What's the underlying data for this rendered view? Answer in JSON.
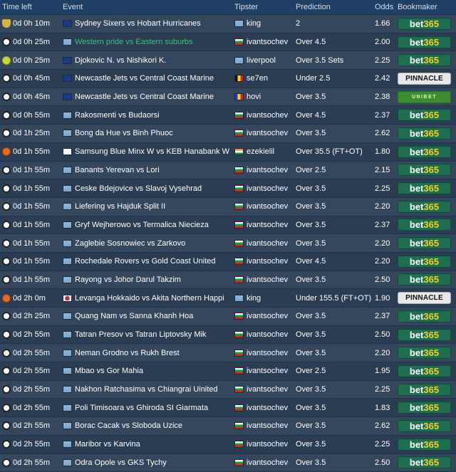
{
  "headers": {
    "time": "Time left",
    "event": "Event",
    "tipster": "Tipster",
    "prediction": "Prediction",
    "odds": "Odds",
    "bookmaker": "Bookmaker"
  },
  "bookmakers": {
    "bet365": "bet365",
    "pinnacle": "PINNACLE",
    "unibet": "UNIBET"
  },
  "colors": {
    "header_bg": "#1f3f64",
    "row_odd": "#34475d",
    "row_even": "#2b3d52",
    "highlight_event": "#3fbf7f",
    "bet365_green": "#1e6e52",
    "bet365_yellow": "#f3d21b"
  },
  "rows": [
    {
      "time": "0d 0h 10m",
      "sport": "trophy-icon",
      "event_flag": "au",
      "event": "Sydney Sixers vs Hobart Hurricanes",
      "highlight": false,
      "tipster_flag": "int",
      "tipster": "king",
      "prediction": "2",
      "odds": "1.66",
      "bookmaker": "bet365"
    },
    {
      "time": "0d 0h 25m",
      "sport": "soccer-ball-icon",
      "event_flag": "int",
      "event": "Western pride vs Eastern suburbs",
      "highlight": true,
      "tipster_flag": "bg",
      "tipster": "ivantsochev",
      "prediction": "Over 4.5",
      "odds": "2.00",
      "bookmaker": "bet365"
    },
    {
      "time": "0d 0h 25m",
      "sport": "tennis-ball-icon",
      "event_flag": "au",
      "event": "Djokovic N. vs Nishikori K.",
      "highlight": false,
      "tipster_flag": "int",
      "tipster": "liverpool",
      "prediction": "Over 3.5 Sets",
      "odds": "2.25",
      "bookmaker": "bet365"
    },
    {
      "time": "0d 0h 45m",
      "sport": "soccer-ball-icon",
      "event_flag": "au",
      "event": "Newcastle Jets vs Central Coast Marine",
      "highlight": false,
      "tipster_flag": "be",
      "tipster": "se7en",
      "prediction": "Under 2.5",
      "odds": "2.42",
      "bookmaker": "pinnacle"
    },
    {
      "time": "0d 0h 45m",
      "sport": "soccer-ball-icon",
      "event_flag": "au",
      "event": "Newcastle Jets vs Central Coast Marine",
      "highlight": false,
      "tipster_flag": "ro",
      "tipster": "hovi",
      "prediction": "Over 3.5",
      "odds": "2.38",
      "bookmaker": "unibet"
    },
    {
      "time": "0d 0h 55m",
      "sport": "soccer-ball-icon",
      "event_flag": "int",
      "event": "Rakosmenti vs Budaorsi",
      "highlight": false,
      "tipster_flag": "bg",
      "tipster": "ivantsochev",
      "prediction": "Over 4.5",
      "odds": "2.37",
      "bookmaker": "bet365"
    },
    {
      "time": "0d 1h 25m",
      "sport": "soccer-ball-icon",
      "event_flag": "int",
      "event": "Bong da Hue vs Binh Phuoc",
      "highlight": false,
      "tipster_flag": "bg",
      "tipster": "ivantsochev",
      "prediction": "Over 3.5",
      "odds": "2.62",
      "bookmaker": "bet365"
    },
    {
      "time": "0d 1h 55m",
      "sport": "basketball-icon",
      "event_flag": "kr",
      "event": "Samsung Blue Minx W vs KEB Hanabank W",
      "highlight": false,
      "tipster_flag": "in",
      "tipster": "ezekielil",
      "prediction": "Over 35.5 (FT+OT)",
      "odds": "1.80",
      "bookmaker": "bet365"
    },
    {
      "time": "0d 1h 55m",
      "sport": "soccer-ball-icon",
      "event_flag": "int",
      "event": "Banants Yerevan vs Lori",
      "highlight": false,
      "tipster_flag": "bg",
      "tipster": "ivantsochev",
      "prediction": "Over 2.5",
      "odds": "2.15",
      "bookmaker": "bet365"
    },
    {
      "time": "0d 1h 55m",
      "sport": "soccer-ball-icon",
      "event_flag": "int",
      "event": "Ceske Bdejovice vs Slavoj Vysehrad",
      "highlight": false,
      "tipster_flag": "bg",
      "tipster": "ivantsochev",
      "prediction": "Over 3.5",
      "odds": "2.25",
      "bookmaker": "bet365"
    },
    {
      "time": "0d 1h 55m",
      "sport": "soccer-ball-icon",
      "event_flag": "int",
      "event": "Liefering vs Hajduk Split II",
      "highlight": false,
      "tipster_flag": "bg",
      "tipster": "ivantsochev",
      "prediction": "Over 3.5",
      "odds": "2.20",
      "bookmaker": "bet365"
    },
    {
      "time": "0d 1h 55m",
      "sport": "soccer-ball-icon",
      "event_flag": "int",
      "event": "Gryf Wejherowo vs Termalica Niecieza",
      "highlight": false,
      "tipster_flag": "bg",
      "tipster": "ivantsochev",
      "prediction": "Over 3.5",
      "odds": "2.37",
      "bookmaker": "bet365"
    },
    {
      "time": "0d 1h 55m",
      "sport": "soccer-ball-icon",
      "event_flag": "int",
      "event": "Zaglebie Sosnowiec vs Zarkovo",
      "highlight": false,
      "tipster_flag": "bg",
      "tipster": "ivantsochev",
      "prediction": "Over 3.5",
      "odds": "2.20",
      "bookmaker": "bet365"
    },
    {
      "time": "0d 1h 55m",
      "sport": "soccer-ball-icon",
      "event_flag": "int",
      "event": "Rochedale Rovers vs Gold Coast United",
      "highlight": false,
      "tipster_flag": "bg",
      "tipster": "ivantsochev",
      "prediction": "Over 4.5",
      "odds": "2.20",
      "bookmaker": "bet365"
    },
    {
      "time": "0d 1h 55m",
      "sport": "soccer-ball-icon",
      "event_flag": "int",
      "event": "Rayong vs Johor Darul Takzim",
      "highlight": false,
      "tipster_flag": "bg",
      "tipster": "ivantsochev",
      "prediction": "Over 3.5",
      "odds": "2.50",
      "bookmaker": "bet365"
    },
    {
      "time": "0d 2h 0m",
      "sport": "basketball-icon",
      "event_flag": "jp",
      "event": "Levanga Hokkaido vs Akita Northern Happi",
      "highlight": false,
      "tipster_flag": "int",
      "tipster": "king",
      "prediction": "Under 155.5 (FT+OT)",
      "odds": "1.90",
      "bookmaker": "pinnacle"
    },
    {
      "time": "0d 2h 25m",
      "sport": "soccer-ball-icon",
      "event_flag": "int",
      "event": "Quang Nam vs Sanna Khanh Hoa",
      "highlight": false,
      "tipster_flag": "bg",
      "tipster": "ivantsochev",
      "prediction": "Over 3.5",
      "odds": "2.37",
      "bookmaker": "bet365"
    },
    {
      "time": "0d 2h 55m",
      "sport": "soccer-ball-icon",
      "event_flag": "int",
      "event": "Tatran Presov vs Tatran Liptovsky Mik",
      "highlight": false,
      "tipster_flag": "bg",
      "tipster": "ivantsochev",
      "prediction": "Over 3.5",
      "odds": "2.50",
      "bookmaker": "bet365"
    },
    {
      "time": "0d 2h 55m",
      "sport": "soccer-ball-icon",
      "event_flag": "int",
      "event": "Neman Grodno vs Rukh Brest",
      "highlight": false,
      "tipster_flag": "bg",
      "tipster": "ivantsochev",
      "prediction": "Over 3.5",
      "odds": "2.20",
      "bookmaker": "bet365"
    },
    {
      "time": "0d 2h 55m",
      "sport": "soccer-ball-icon",
      "event_flag": "int",
      "event": "Mbao vs Gor Mahia",
      "highlight": false,
      "tipster_flag": "bg",
      "tipster": "ivantsochev",
      "prediction": "Over 2.5",
      "odds": "1.95",
      "bookmaker": "bet365"
    },
    {
      "time": "0d 2h 55m",
      "sport": "soccer-ball-icon",
      "event_flag": "int",
      "event": "Nakhon Ratchasima vs Chiangrai Uinited",
      "highlight": false,
      "tipster_flag": "bg",
      "tipster": "ivantsochev",
      "prediction": "Over 3.5",
      "odds": "2.25",
      "bookmaker": "bet365"
    },
    {
      "time": "0d 2h 55m",
      "sport": "soccer-ball-icon",
      "event_flag": "int",
      "event": "Poli Timisoara vs Ghiroda SI Giarmata",
      "highlight": false,
      "tipster_flag": "bg",
      "tipster": "ivantsochev",
      "prediction": "Over 3.5",
      "odds": "1.83",
      "bookmaker": "bet365"
    },
    {
      "time": "0d 2h 55m",
      "sport": "soccer-ball-icon",
      "event_flag": "int",
      "event": "Borac Cacak vs Sloboda Uzice",
      "highlight": false,
      "tipster_flag": "bg",
      "tipster": "ivantsochev",
      "prediction": "Over 3.5",
      "odds": "2.62",
      "bookmaker": "bet365"
    },
    {
      "time": "0d 2h 55m",
      "sport": "soccer-ball-icon",
      "event_flag": "int",
      "event": "Maribor vs Karvina",
      "highlight": false,
      "tipster_flag": "bg",
      "tipster": "ivantsochev",
      "prediction": "Over 3.5",
      "odds": "2.25",
      "bookmaker": "bet365"
    },
    {
      "time": "0d 2h 55m",
      "sport": "soccer-ball-icon",
      "event_flag": "int",
      "event": "Odra Opole vs GKS Tychy",
      "highlight": false,
      "tipster_flag": "bg",
      "tipster": "ivantsochev",
      "prediction": "Over 3.5",
      "odds": "2.50",
      "bookmaker": "bet365"
    }
  ]
}
